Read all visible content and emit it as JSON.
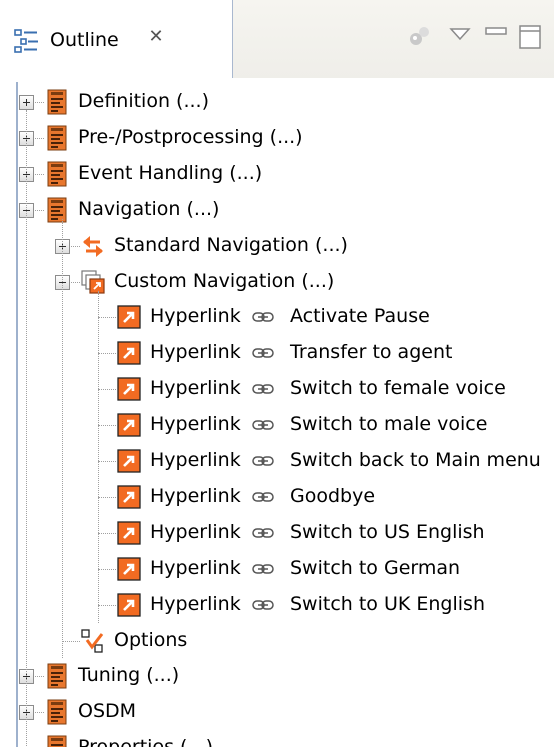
{
  "tab": {
    "title": "Outline",
    "close_glyph": "✕"
  },
  "colors": {
    "accent": "#f26b22",
    "doc_orange": "#e8772e",
    "tree_line": "#a0a0a0"
  },
  "tree": [
    {
      "label": "Definition (...)",
      "icon": "document-icon",
      "expanded": false
    },
    {
      "label": "Pre-/Postprocessing (...)",
      "icon": "document-icon",
      "expanded": false
    },
    {
      "label": "Event Handling (...)",
      "icon": "document-icon",
      "expanded": false
    },
    {
      "label": "Navigation (...)",
      "icon": "document-icon",
      "expanded": true,
      "children": [
        {
          "label": "Standard Navigation (...)",
          "icon": "swap-arrows-icon",
          "expanded": false
        },
        {
          "label": "Custom Navigation (...)",
          "icon": "custom-navigation-icon",
          "expanded": true,
          "children": [
            {
              "type": "Hyperlink",
              "target": "Activate Pause"
            },
            {
              "type": "Hyperlink",
              "target": "Transfer to agent"
            },
            {
              "type": "Hyperlink",
              "target": "Switch to female voice"
            },
            {
              "type": "Hyperlink",
              "target": "Switch to male voice"
            },
            {
              "type": "Hyperlink",
              "target": "Switch back to Main menu"
            },
            {
              "type": "Hyperlink",
              "target": "Goodbye"
            },
            {
              "type": "Hyperlink",
              "target": "Switch to US English"
            },
            {
              "type": "Hyperlink",
              "target": "Switch to German"
            },
            {
              "type": "Hyperlink",
              "target": "Switch to UK English"
            }
          ]
        },
        {
          "label": "Options",
          "icon": "options-icon"
        }
      ]
    },
    {
      "label": "Tuning (...)",
      "icon": "document-icon",
      "expanded": false
    },
    {
      "label": "OSDM",
      "icon": "document-icon",
      "expanded": false
    },
    {
      "label": "Properties (...)",
      "icon": "document-icon"
    }
  ]
}
